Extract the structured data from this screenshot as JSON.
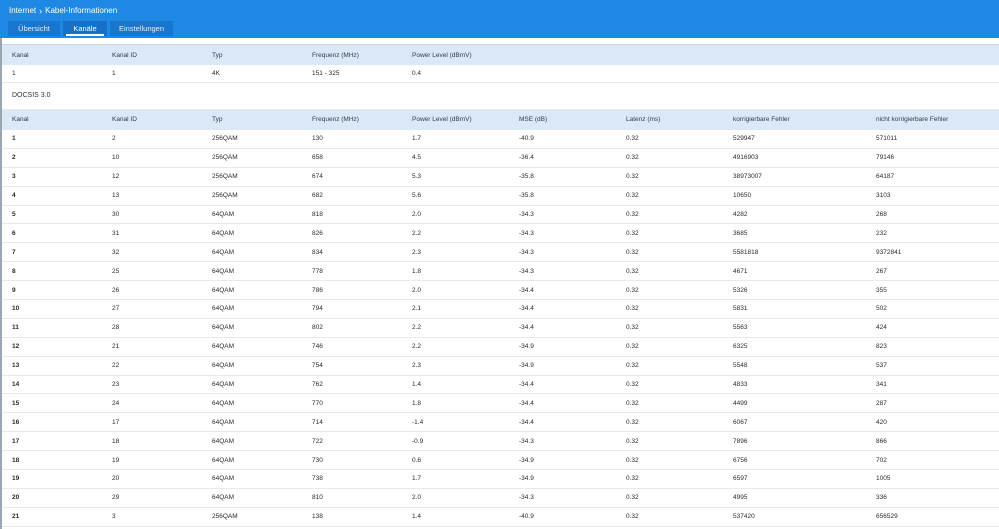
{
  "breadcrumb": {
    "root": "Internet",
    "current": "Kabel-Informationen"
  },
  "tabs": [
    {
      "label": "Übersicht"
    },
    {
      "label": "Kanäle"
    },
    {
      "label": "Einstellungen"
    }
  ],
  "top_table": {
    "headers": [
      "Kanal",
      "Kanal ID",
      "Typ",
      "Frequenz (MHz)",
      "Power Level (dBmV)"
    ],
    "rows": [
      [
        "1",
        "1",
        "4K",
        "151 - 325",
        "0.4"
      ]
    ]
  },
  "docsis_section": {
    "label": "DOCSIS 3.0",
    "headers": [
      "Kanal",
      "Kanal ID",
      "Typ",
      "Frequenz (MHz)",
      "Power Level (dBmV)",
      "MSE (dB)",
      "Latenz (ms)",
      "korrigierbare Fehler",
      "nicht korrigierbare Fehler"
    ],
    "rows": [
      [
        "1",
        "2",
        "256QAM",
        "130",
        "1.7",
        "-40.9",
        "0.32",
        "529947",
        "571011"
      ],
      [
        "2",
        "10",
        "256QAM",
        "658",
        "4.5",
        "-36.4",
        "0.32",
        "4916903",
        "79146"
      ],
      [
        "3",
        "12",
        "256QAM",
        "674",
        "5.3",
        "-35.8",
        "0.32",
        "38973007",
        "64187"
      ],
      [
        "4",
        "13",
        "256QAM",
        "682",
        "5.6",
        "-35.8",
        "0.32",
        "10650",
        "3103"
      ],
      [
        "5",
        "30",
        "64QAM",
        "818",
        "2.0",
        "-34.3",
        "0.32",
        "4282",
        "268"
      ],
      [
        "6",
        "31",
        "64QAM",
        "826",
        "2.2",
        "-34.3",
        "0.32",
        "3685",
        "232"
      ],
      [
        "7",
        "32",
        "64QAM",
        "834",
        "2.3",
        "-34.3",
        "0.32",
        "5581818",
        "9372841"
      ],
      [
        "8",
        "25",
        "64QAM",
        "778",
        "1.8",
        "-34.3",
        "0.32",
        "4671",
        "267"
      ],
      [
        "9",
        "26",
        "64QAM",
        "786",
        "2.0",
        "-34.4",
        "0.32",
        "5326",
        "355"
      ],
      [
        "10",
        "27",
        "64QAM",
        "794",
        "2.1",
        "-34.4",
        "0.32",
        "5831",
        "502"
      ],
      [
        "11",
        "28",
        "64QAM",
        "802",
        "2.2",
        "-34.4",
        "0.32",
        "5563",
        "424"
      ],
      [
        "12",
        "21",
        "64QAM",
        "746",
        "2.2",
        "-34.9",
        "0.32",
        "6325",
        "823"
      ],
      [
        "13",
        "22",
        "64QAM",
        "754",
        "2.3",
        "-34.9",
        "0.32",
        "5548",
        "537"
      ],
      [
        "14",
        "23",
        "64QAM",
        "762",
        "1.4",
        "-34.4",
        "0.32",
        "4833",
        "341"
      ],
      [
        "15",
        "24",
        "64QAM",
        "770",
        "1.8",
        "-34.4",
        "0.32",
        "4499",
        "287"
      ],
      [
        "16",
        "17",
        "64QAM",
        "714",
        "-1.4",
        "-34.4",
        "0.32",
        "6067",
        "420"
      ],
      [
        "17",
        "18",
        "64QAM",
        "722",
        "-0.9",
        "-34.3",
        "0.32",
        "7896",
        "866"
      ],
      [
        "18",
        "19",
        "64QAM",
        "730",
        "0.6",
        "-34.9",
        "0.32",
        "6756",
        "702"
      ],
      [
        "19",
        "20",
        "64QAM",
        "738",
        "1.7",
        "-34.9",
        "0.32",
        "6597",
        "1005"
      ],
      [
        "20",
        "29",
        "64QAM",
        "810",
        "2.0",
        "-34.3",
        "0.32",
        "4995",
        "336"
      ],
      [
        "21",
        "3",
        "256QAM",
        "138",
        "1.4",
        "-40.9",
        "0.32",
        "537420",
        "656529"
      ]
    ]
  },
  "colors": {
    "header_blue": "#1e88e5",
    "tab_bg": "#1876cf",
    "table_header_bg": "#dbe9f7"
  }
}
